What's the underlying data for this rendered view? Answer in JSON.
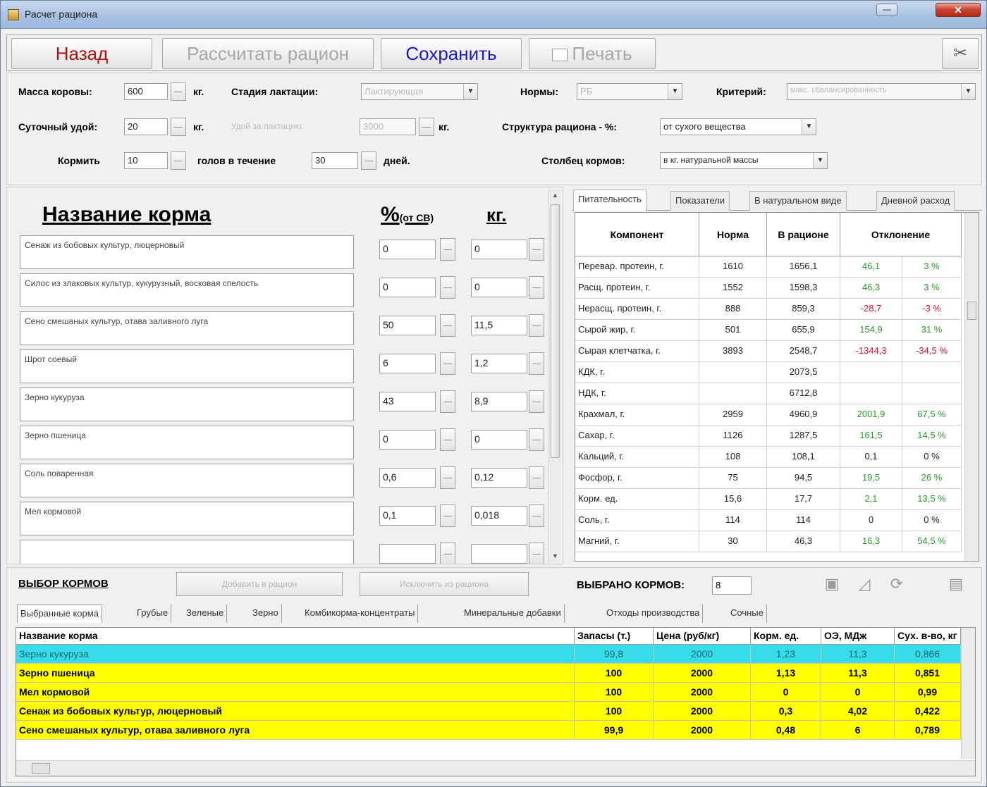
{
  "window": {
    "title": "Расчет рациона",
    "close": "✕",
    "minimize": "—"
  },
  "toolbar": {
    "back": "Назад",
    "calculate": "Рассчитать рацион",
    "save": "Сохранить",
    "print": "Печать",
    "tools_icon": "tools-icon"
  },
  "params": {
    "cow_mass_label": "Масса коровы:",
    "cow_mass_value": "600",
    "cow_mass_unit": "кг.",
    "lactation_label": "Стадия лактации:",
    "lactation_value": "Лактирующая",
    "norms_label": "Нормы:",
    "norms_value": "РБ",
    "criterion_label": "Критерий:",
    "criterion_value": "макс. сбалансированность",
    "daily_yield_label": "Суточный удой:",
    "daily_yield_value": "20",
    "daily_yield_unit": "кг.",
    "yield_per_lactation_label": "Удой за лактацию:",
    "yield_per_lactation_value": "3000",
    "yield_per_lactation_unit": "кг.",
    "ration_structure_label": "Структура рациона - %:",
    "ration_structure_value": "от сухого вещества",
    "feed_label": "Кормить",
    "feed_heads_value": "10",
    "heads_during_label": "голов в течение",
    "days_value": "30",
    "days_unit": "дней.",
    "feed_column_label": "Столбец кормов:",
    "feed_column_value": "в кг. натуральной массы"
  },
  "ration": {
    "name_header": "Название корма",
    "pct_header": "%",
    "pct_sub": "(от СВ)",
    "kg_header": "кг.",
    "items": [
      {
        "name": "Сенаж из  бобовых культур, люцерновый",
        "pct": "0",
        "kg": "0"
      },
      {
        "name": "Силос из злаковых культур, кукурузный, восковая спелость",
        "pct": "0",
        "kg": "0"
      },
      {
        "name": "Сено смешаных культур, отава заливного луга",
        "pct": "50",
        "kg": "11,5"
      },
      {
        "name": "Шрот соевый",
        "pct": "6",
        "kg": "1,2"
      },
      {
        "name": "Зерно кукуруза",
        "pct": "43",
        "kg": "8,9"
      },
      {
        "name": "Зерно пшеница",
        "pct": "0",
        "kg": "0"
      },
      {
        "name": "Соль поваренная",
        "pct": "0,6",
        "kg": "0,12"
      },
      {
        "name": "Мел кормовой",
        "pct": "0,1",
        "kg": "0,018"
      },
      {
        "name": "",
        "pct": "",
        "kg": ""
      }
    ]
  },
  "nutrition": {
    "tabs": [
      "Питательность",
      "Показатели",
      "В натуральном виде",
      "Дневной расход"
    ],
    "headers": [
      "Компонент",
      "Норма",
      "В рационе",
      "Отклонение"
    ],
    "rows": [
      {
        "name": "Перевар. протеин, г.",
        "norm": "1610",
        "ration": "1656,1",
        "dev": "46,1",
        "devpct": "3 %",
        "sign": "pos"
      },
      {
        "name": "Расщ. протеин, г.",
        "norm": "1552",
        "ration": "1598,3",
        "dev": "46,3",
        "devpct": "3 %",
        "sign": "pos"
      },
      {
        "name": "Нерасщ. протеин, г.",
        "norm": "888",
        "ration": "859,3",
        "dev": "-28,7",
        "devpct": "-3 %",
        "sign": "neg"
      },
      {
        "name": "Сырой жир, г.",
        "norm": "501",
        "ration": "655,9",
        "dev": "154,9",
        "devpct": "31 %",
        "sign": "pos"
      },
      {
        "name": "Сырая клетчатка, г.",
        "norm": "3893",
        "ration": "2548,7",
        "dev": "-1344,3",
        "devpct": "-34,5 %",
        "sign": "neg"
      },
      {
        "name": "КДК, г.",
        "norm": "",
        "ration": "2073,5",
        "dev": "",
        "devpct": "",
        "sign": "pos"
      },
      {
        "name": "НДК, г.",
        "norm": "",
        "ration": "6712,8",
        "dev": "",
        "devpct": "",
        "sign": "pos"
      },
      {
        "name": "Крахмал, г.",
        "norm": "2959",
        "ration": "4960,9",
        "dev": "2001,9",
        "devpct": "67,5 %",
        "sign": "pos"
      },
      {
        "name": "Сахар, г.",
        "norm": "1126",
        "ration": "1287,5",
        "dev": "161,5",
        "devpct": "14,5 %",
        "sign": "pos"
      },
      {
        "name": "Кальций, г.",
        "norm": "108",
        "ration": "108,1",
        "dev": "0,1",
        "devpct": "0 %",
        "sign": "zero"
      },
      {
        "name": "Фосфор, г.",
        "norm": "75",
        "ration": "94,5",
        "dev": "19,5",
        "devpct": "26 %",
        "sign": "pos"
      },
      {
        "name": "Корм. ед.",
        "norm": "15,6",
        "ration": "17,7",
        "dev": "2,1",
        "devpct": "13,5 %",
        "sign": "pos"
      },
      {
        "name": "Соль, г.",
        "norm": "114",
        "ration": "114",
        "dev": "0",
        "devpct": "0 %",
        "sign": "zero"
      },
      {
        "name": "Магний, г.",
        "norm": "30",
        "ration": "46,3",
        "dev": "16,3",
        "devpct": "54,5 %",
        "sign": "pos"
      }
    ]
  },
  "selection": {
    "title": "ВЫБОР КОРМОВ",
    "add_btn": "Добавить в рацион",
    "remove_btn": "Исключить из рациона",
    "selected_label": "ВЫБРАНО КОРМОВ:",
    "selected_count": "8",
    "tabs": [
      "Выбранные корма",
      "Грубые",
      "Зеленые",
      "Зерно",
      "Комбикорма-концентраты",
      "Минеральные добавки",
      "Отходы производства",
      "Сочные"
    ],
    "headers": [
      "Название корма",
      "Запасы (т.)",
      "Цена (руб/кг)",
      "Корм. ед.",
      "ОЭ, МДж",
      "Сух. в-во, кг"
    ],
    "rows": [
      {
        "name": "Зерно кукуруза",
        "stock": "99,8",
        "price": "2000",
        "fu": "1,23",
        "me": "11,3",
        "dm": "0,866",
        "style": "selected"
      },
      {
        "name": "Зерно пшеница",
        "stock": "100",
        "price": "2000",
        "fu": "1,13",
        "me": "11,3",
        "dm": "0,851",
        "style": "yellow"
      },
      {
        "name": "Мел кормовой",
        "stock": "100",
        "price": "2000",
        "fu": "0",
        "me": "0",
        "dm": "0,99",
        "style": "yellow"
      },
      {
        "name": "Сенаж из  бобовых культур, люцерновый",
        "stock": "100",
        "price": "2000",
        "fu": "0,3",
        "me": "4,02",
        "dm": "0,422",
        "style": "yellow"
      },
      {
        "name": "Сено смешаных культур, отава заливного луга",
        "stock": "99,9",
        "price": "2000",
        "fu": "0,48",
        "me": "6",
        "dm": "0,789",
        "style": "yellow"
      }
    ]
  },
  "colors": {
    "selected_row": "#36dcea",
    "yellow_row": "#ffff00",
    "positive": "#2a9a2a",
    "negative": "#e01030"
  }
}
